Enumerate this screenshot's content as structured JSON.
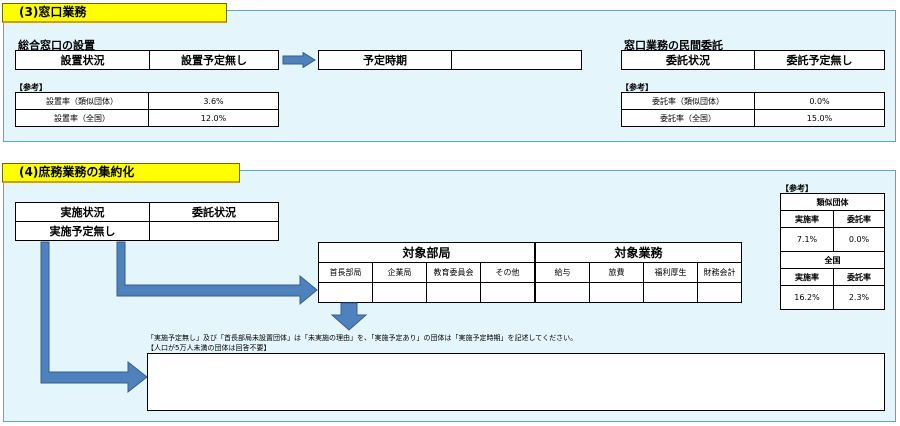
{
  "section3": {
    "title": "(3)窓口業務",
    "left": {
      "heading": "総合窓口の設置",
      "status_label": "設置状況",
      "status_value": "設置予定無し",
      "schedule_label": "予定時期",
      "schedule_value": "",
      "ref_label": "【参考】",
      "ref_rows": [
        {
          "label": "設置率（類似団体）",
          "value": "3.6%"
        },
        {
          "label": "設置率（全国）",
          "value": "12.0%"
        }
      ]
    },
    "right": {
      "heading": "窓口業務の民間委託",
      "status_label": "委託状況",
      "status_value": "委託予定無し",
      "ref_label": "【参考】",
      "ref_rows": [
        {
          "label": "委託率（類似団体）",
          "value": "0.0%"
        },
        {
          "label": "委託率（全国）",
          "value": "15.0%"
        }
      ]
    }
  },
  "section4": {
    "title": "(4)庶務業務の集約化",
    "status_header": "実施状況",
    "contract_header": "委託状況",
    "status_value": "実施予定無し",
    "contract_value": "",
    "dept_header": "対象部局",
    "dept_cols": [
      "首長部局",
      "企業局",
      "教育委員会",
      "その他"
    ],
    "biz_header": "対象業務",
    "biz_cols": [
      "給与",
      "旅費",
      "福利厚生",
      "財務会計"
    ],
    "note_line1": "「実施予定無し」及び「首長部局未設置団体」は「未実施の理由」を、「実施予定あり」の団体は「実施予定時期」を記述してください。",
    "note_line2": "【人口が5万人未満の団体は回答不要】",
    "comment_value": "",
    "ref": {
      "label": "【参考】",
      "similar_header": "類似団体",
      "national_header": "全国",
      "col1": "実施率",
      "col2": "委託率",
      "similar_values": [
        "7.1%",
        "0.0%"
      ],
      "national_values": [
        "16.2%",
        "2.3%"
      ]
    }
  }
}
